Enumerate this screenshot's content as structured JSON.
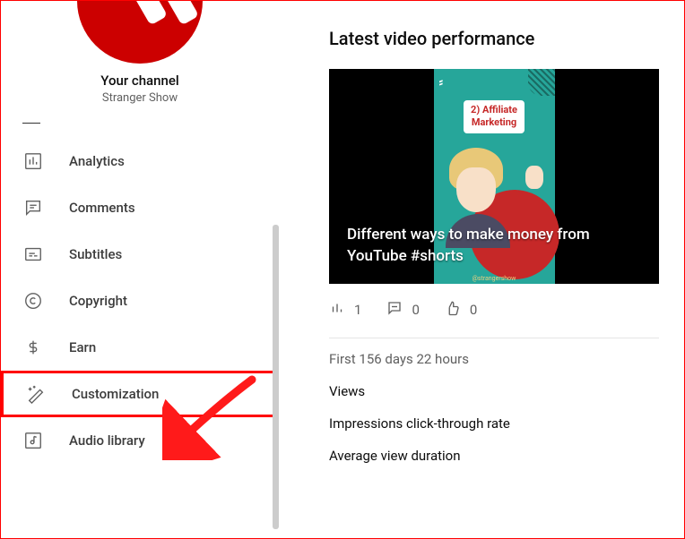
{
  "sidebar": {
    "your_channel_label": "Your channel",
    "channel_name": "Stranger Show",
    "items": [
      {
        "label": "Analytics",
        "icon": "analytics"
      },
      {
        "label": "Comments",
        "icon": "comments"
      },
      {
        "label": "Subtitles",
        "icon": "subtitles"
      },
      {
        "label": "Copyright",
        "icon": "copyright"
      },
      {
        "label": "Earn",
        "icon": "earn"
      },
      {
        "label": "Customization",
        "icon": "customization"
      },
      {
        "label": "Audio library",
        "icon": "audio-library"
      }
    ]
  },
  "main": {
    "section_title": "Latest video performance",
    "video_title": "Different ways to make money from YouTube #shorts",
    "short_card_line1": "2) Affiliate",
    "short_card_line2": "Marketing",
    "short_watermark": "@strangershow",
    "stats": {
      "analytics_count": "1",
      "comments_count": "0",
      "likes_count": "0"
    },
    "period": "First 156 days 22 hours",
    "metrics": [
      "Views",
      "Impressions click-through rate",
      "Average view duration"
    ]
  }
}
